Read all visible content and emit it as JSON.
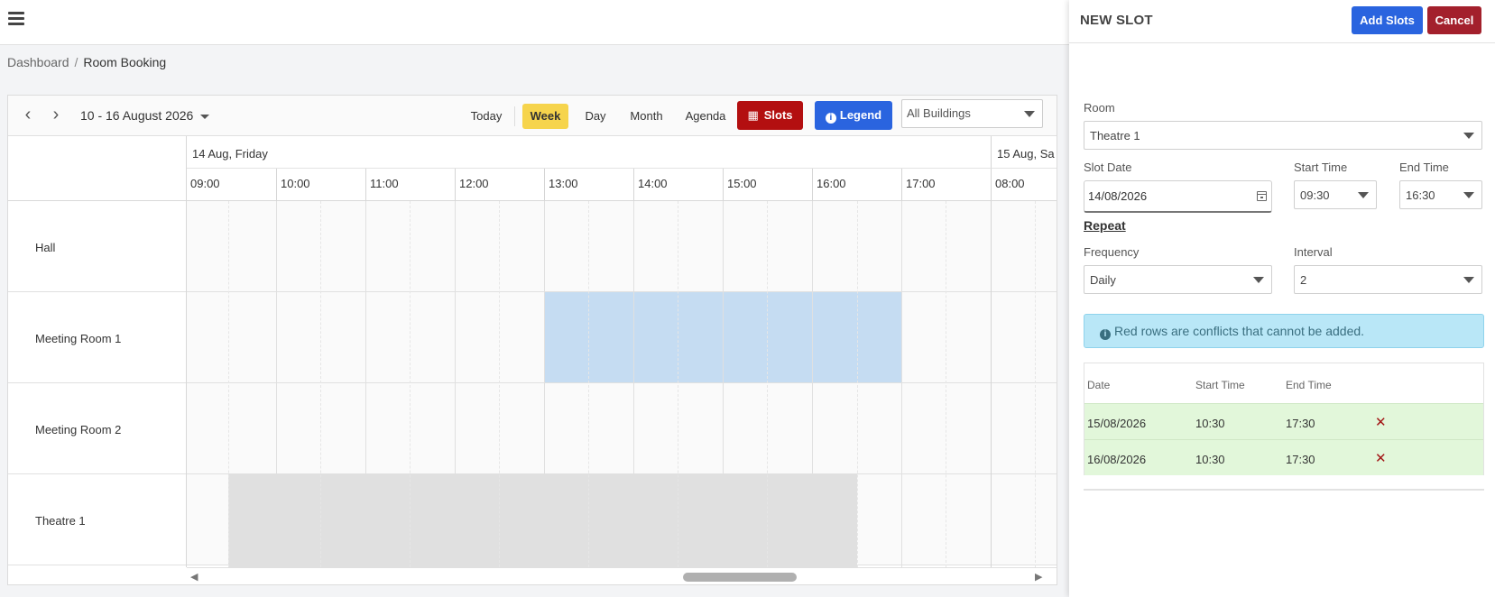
{
  "breadcrumb": {
    "root": "Dashboard",
    "current": "Room Booking"
  },
  "toolbar": {
    "date_range": "10 - 16 August 2026",
    "today": "Today",
    "week": "Week",
    "day": "Day",
    "month": "Month",
    "agenda": "Agenda",
    "slots_label": "Slots",
    "legend_label": "Legend",
    "building_select": "All Buildings",
    "active_view": "Week"
  },
  "scheduler": {
    "days": [
      "14 Aug, Friday",
      "15 Aug, Sa"
    ],
    "hours": [
      "09:00",
      "10:00",
      "11:00",
      "12:00",
      "13:00",
      "14:00",
      "15:00",
      "16:00",
      "17:00",
      "08:00"
    ],
    "rooms": [
      "Hall",
      "Meeting Room 1",
      "Meeting Room 2",
      "Theatre 1"
    ],
    "colors": {
      "selected_block": "#c5dcf2",
      "booked_block": "#e0e0e0"
    }
  },
  "panel": {
    "title": "NEW SLOT",
    "add_label": "Add Slots",
    "cancel_label": "Cancel",
    "room_label": "Room",
    "room_value": "Theatre 1",
    "slot_date_label": "Slot Date",
    "slot_date_value": "14/08/2026",
    "start_time_label": "Start Time",
    "start_time_value": "09:30",
    "end_time_label": "End Time",
    "end_time_value": "16:30",
    "repeat_label": "Repeat",
    "frequency_label": "Frequency",
    "frequency_value": "Daily",
    "interval_label": "Interval",
    "interval_value": "2",
    "alert_text": "Red rows are conflicts that cannot be added.",
    "table": {
      "headers": [
        "Date",
        "Start Time",
        "End Time"
      ],
      "rows": [
        {
          "date": "15/08/2026",
          "start": "10:30",
          "end": "17:30"
        },
        {
          "date": "16/08/2026",
          "start": "10:30",
          "end": "17:30"
        }
      ]
    },
    "colors": {
      "add": "#2a64df",
      "cancel": "#a3202c",
      "ok_row": "#e2f7da",
      "alert_bg": "#b9e7f7"
    }
  }
}
